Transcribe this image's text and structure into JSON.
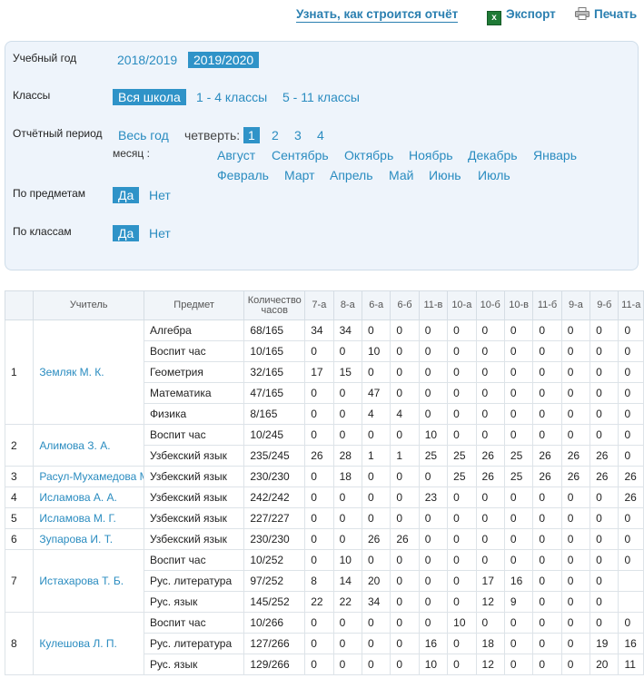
{
  "toolbar": {
    "howto_label": "Узнать, как строится отчёт",
    "export_label": "Экспорт",
    "print_label": "Печать"
  },
  "filters": {
    "year_label": "Учебный год",
    "years": [
      "2018/2019",
      "2019/2020"
    ],
    "year_selected": "2019/2020",
    "classes_label": "Классы",
    "classes": [
      "Вся школа",
      "1 - 4 классы",
      "5 - 11 классы"
    ],
    "classes_selected": "Вся школа",
    "period_label": "Отчётный период",
    "whole_year": "Весь год",
    "quarter_label": "четверть:",
    "quarters": [
      "1",
      "2",
      "3",
      "4"
    ],
    "quarter_selected": "1",
    "month_label": "месяц :",
    "months_row1": [
      "Август",
      "Сентябрь",
      "Октябрь",
      "Ноябрь",
      "Декабрь",
      "Январь"
    ],
    "months_row2": [
      "Февраль",
      "Март",
      "Апрель",
      "Май",
      "Июнь",
      "Июль"
    ],
    "by_subject_label": "По предметам",
    "by_class_label": "По классам",
    "yes": "Да",
    "no": "Нет",
    "accent_color": "#2f93c8"
  },
  "table": {
    "headers": [
      "",
      "Учитель",
      "Предмет",
      "Количество часов",
      "7-а",
      "8-а",
      "6-а",
      "6-б",
      "11-в",
      "10-а",
      "10-б",
      "10-в",
      "11-б",
      "9-а",
      "9-б",
      "11-а"
    ],
    "rows": [
      {
        "n": "1",
        "teacher": "Земляк М. К.",
        "subjects": [
          {
            "s": "Алгебра",
            "h": "68/165",
            "v": [
              "34",
              "34",
              "0",
              "0",
              "0",
              "0",
              "0",
              "0",
              "0",
              "0",
              "0",
              "0"
            ]
          },
          {
            "s": "Воспит час",
            "h": "10/165",
            "v": [
              "0",
              "0",
              "10",
              "0",
              "0",
              "0",
              "0",
              "0",
              "0",
              "0",
              "0",
              "0"
            ]
          },
          {
            "s": "Геометрия",
            "h": "32/165",
            "v": [
              "17",
              "15",
              "0",
              "0",
              "0",
              "0",
              "0",
              "0",
              "0",
              "0",
              "0",
              "0"
            ]
          },
          {
            "s": "Математика",
            "h": "47/165",
            "v": [
              "0",
              "0",
              "47",
              "0",
              "0",
              "0",
              "0",
              "0",
              "0",
              "0",
              "0",
              "0"
            ]
          },
          {
            "s": "Физика",
            "h": "8/165",
            "v": [
              "0",
              "0",
              "4",
              "4",
              "0",
              "0",
              "0",
              "0",
              "0",
              "0",
              "0",
              "0"
            ]
          }
        ]
      },
      {
        "n": "2",
        "teacher": "Алимова З. А.",
        "subjects": [
          {
            "s": "Воспит час",
            "h": "10/245",
            "v": [
              "0",
              "0",
              "0",
              "0",
              "10",
              "0",
              "0",
              "0",
              "0",
              "0",
              "0",
              "0"
            ]
          },
          {
            "s": "Узбекский язык",
            "h": "235/245",
            "v": [
              "26",
              "28",
              "1",
              "1",
              "25",
              "25",
              "26",
              "25",
              "26",
              "26",
              "26",
              "0"
            ]
          }
        ]
      },
      {
        "n": "3",
        "teacher": "Расул-Мухамедова М. П.",
        "subjects": [
          {
            "s": "Узбекский язык",
            "h": "230/230",
            "v": [
              "0",
              "18",
              "0",
              "0",
              "0",
              "25",
              "26",
              "25",
              "26",
              "26",
              "26",
              "26"
            ]
          }
        ]
      },
      {
        "n": "4",
        "teacher": "Исламова А. А.",
        "subjects": [
          {
            "s": "Узбекский язык",
            "h": "242/242",
            "v": [
              "0",
              "0",
              "0",
              "0",
              "23",
              "0",
              "0",
              "0",
              "0",
              "0",
              "0",
              "26"
            ]
          }
        ]
      },
      {
        "n": "5",
        "teacher": "Исламова М. Г.",
        "subjects": [
          {
            "s": "Узбекский язык",
            "h": "227/227",
            "v": [
              "0",
              "0",
              "0",
              "0",
              "0",
              "0",
              "0",
              "0",
              "0",
              "0",
              "0",
              "0"
            ]
          }
        ]
      },
      {
        "n": "6",
        "teacher": "Зупарова И. Т.",
        "subjects": [
          {
            "s": "Узбекский язык",
            "h": "230/230",
            "v": [
              "0",
              "0",
              "26",
              "26",
              "0",
              "0",
              "0",
              "0",
              "0",
              "0",
              "0",
              "0"
            ]
          }
        ]
      },
      {
        "n": "7",
        "teacher": "Истахарова Т. Б.",
        "subjects": [
          {
            "s": "Воспит час",
            "h": "10/252",
            "v": [
              "0",
              "10",
              "0",
              "0",
              "0",
              "0",
              "0",
              "0",
              "0",
              "0",
              "0",
              "0"
            ]
          },
          {
            "s": "Рус. литература",
            "h": "97/252",
            "v": [
              "8",
              "14",
              "20",
              "0",
              "0",
              "0",
              "17",
              "16",
              "0",
              "0",
              "0",
              ""
            ]
          },
          {
            "s": "Рус. язык",
            "h": "145/252",
            "v": [
              "22",
              "22",
              "34",
              "0",
              "0",
              "0",
              "12",
              "9",
              "0",
              "0",
              "0",
              ""
            ]
          }
        ]
      },
      {
        "n": "8",
        "teacher": "Кулешова Л. П.",
        "subjects": [
          {
            "s": "Воспит час",
            "h": "10/266",
            "v": [
              "0",
              "0",
              "0",
              "0",
              "0",
              "10",
              "0",
              "0",
              "0",
              "0",
              "0",
              "0"
            ]
          },
          {
            "s": "Рус. литература",
            "h": "127/266",
            "v": [
              "0",
              "0",
              "0",
              "0",
              "16",
              "0",
              "18",
              "0",
              "0",
              "0",
              "19",
              "16"
            ]
          },
          {
            "s": "Рус. язык",
            "h": "129/266",
            "v": [
              "0",
              "0",
              "0",
              "0",
              "10",
              "0",
              "12",
              "0",
              "0",
              "0",
              "20",
              "11"
            ]
          }
        ]
      }
    ]
  }
}
